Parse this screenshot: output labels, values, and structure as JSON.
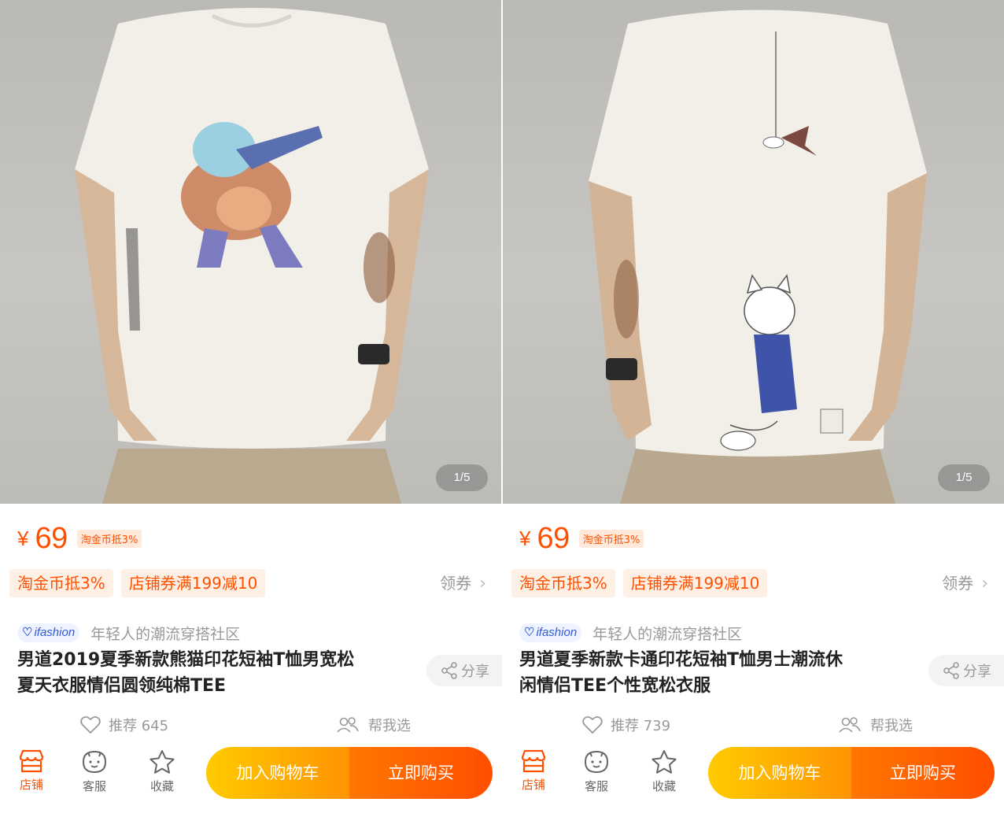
{
  "panels": [
    {
      "image_alt": "Model wearing white t-shirt with dabbing panda print",
      "page_indicator": "1/5",
      "currency": "¥",
      "price": "69",
      "coin_tag": "淘金币抵3%",
      "promos": [
        "淘金币抵3%",
        "店铺券满199减10"
      ],
      "coupon_link": "领券",
      "brand_name": "ifashion",
      "brand_slogan": "年轻人的潮流穿搭社区",
      "title_line1": "男道2019夏季新款熊猫印花短袖T恤男宽松",
      "title_line2": "夏天衣服情侣圆领纯棉TEE",
      "share": "分享",
      "recommend": "推荐 645",
      "help_pick": "帮我选",
      "nav": {
        "store": "店铺",
        "service": "客服",
        "favorite": "收藏"
      },
      "add_to_cart": "加入购物车",
      "buy_now": "立即购买"
    },
    {
      "image_alt": "Model back view wearing white t-shirt with cartoon cat print",
      "page_indicator": "1/5",
      "currency": "¥",
      "price": "69",
      "coin_tag": "淘金币抵3%",
      "promos": [
        "淘金币抵3%",
        "店铺券满199减10"
      ],
      "coupon_link": "领券",
      "brand_name": "ifashion",
      "brand_slogan": "年轻人的潮流穿搭社区",
      "title_line1": "男道夏季新款卡通印花短袖T恤男士潮流休",
      "title_line2": "闲情侣TEE个性宽松衣服",
      "share": "分享",
      "recommend": "推荐 739",
      "help_pick": "帮我选",
      "nav": {
        "store": "店铺",
        "service": "客服",
        "favorite": "收藏"
      },
      "add_to_cart": "加入购物车",
      "buy_now": "立即购买"
    }
  ],
  "colors": {
    "accent": "#ff5000",
    "cart_gradient": [
      "#ffcb00",
      "#ff9402"
    ],
    "buy_gradient": [
      "#ff7700",
      "#ff4e00"
    ],
    "muted": "#999999"
  },
  "icons": [
    "heart-icon",
    "people-icon",
    "share-icon",
    "store-icon",
    "service-icon",
    "star-icon"
  ]
}
